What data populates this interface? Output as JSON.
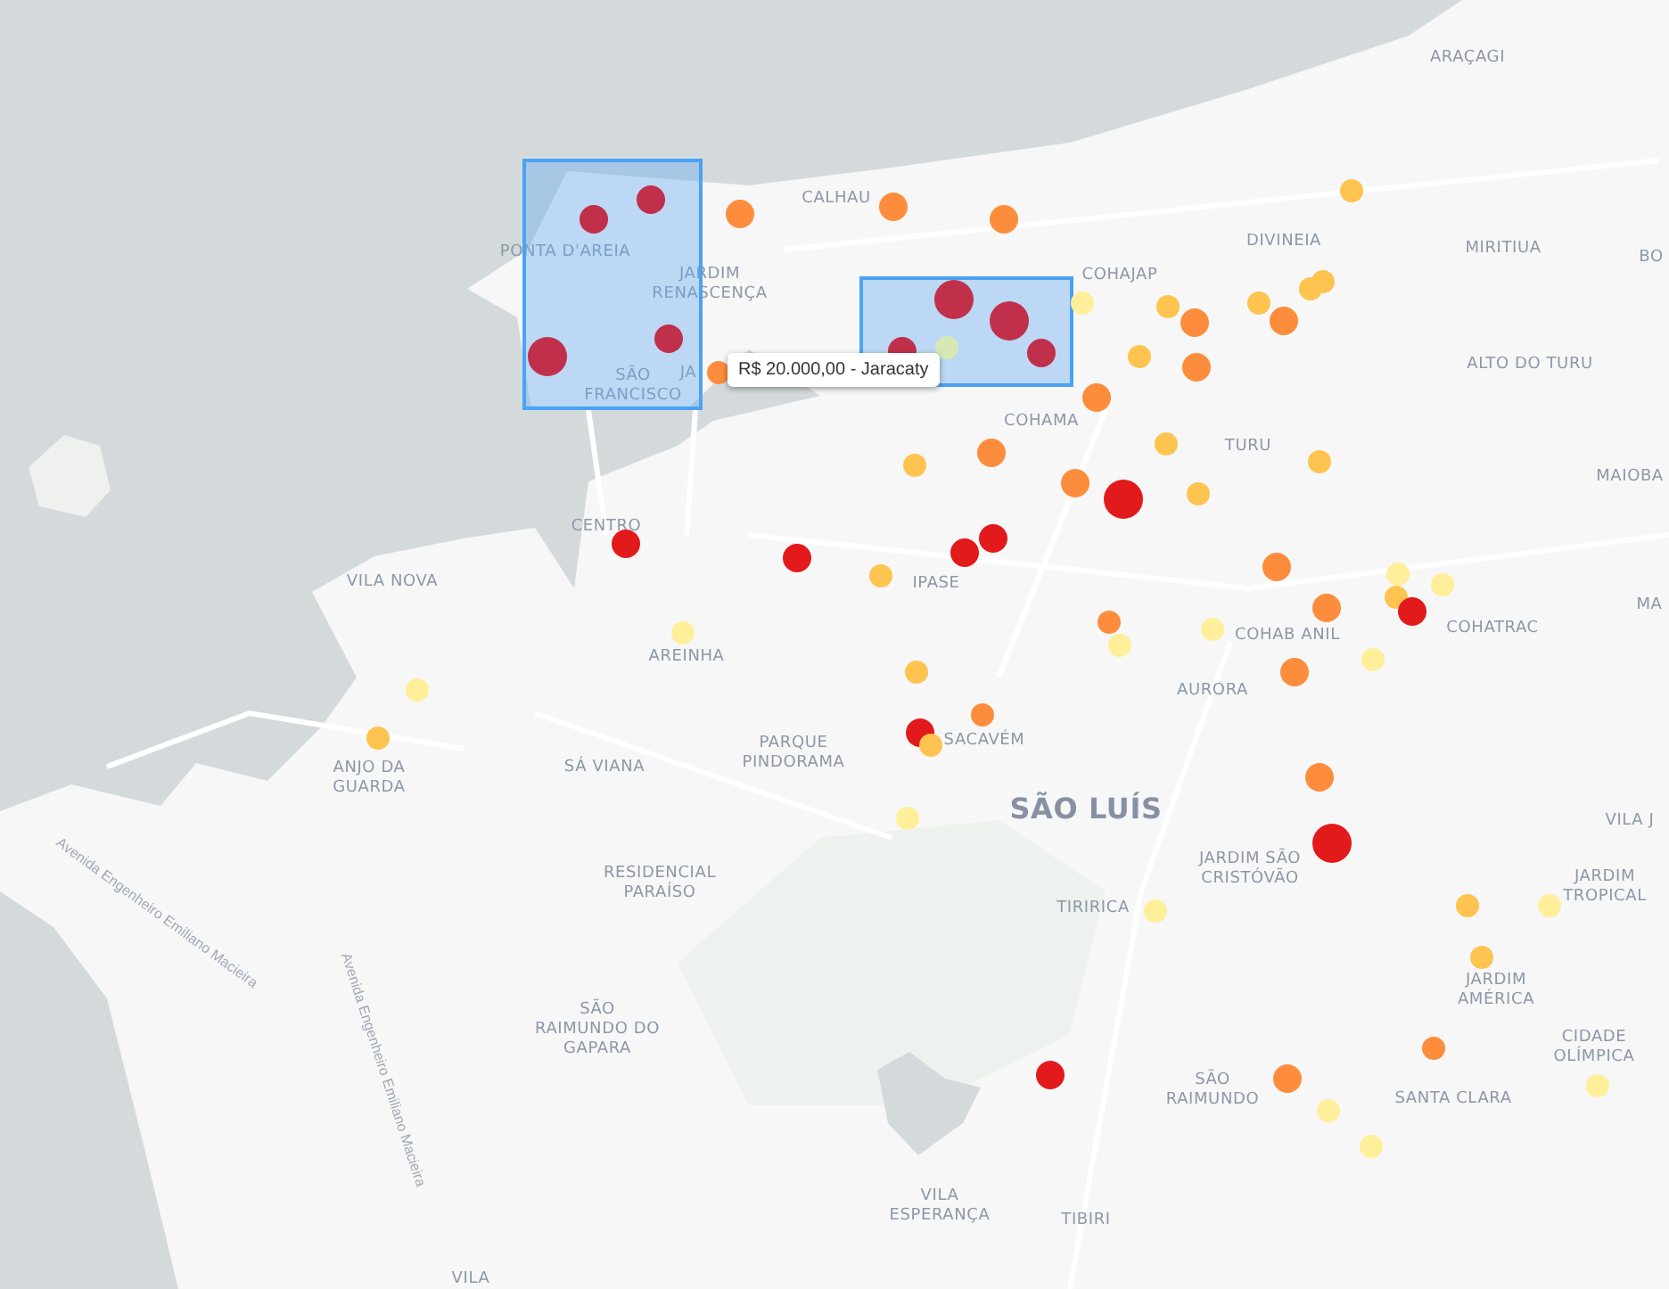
{
  "map": {
    "places": [
      {
        "text": "ARAÇAGI"
      },
      {
        "text": "CALHAU"
      },
      {
        "text": "PONTA D'AREIA"
      },
      {
        "text": "JARDIM RENASCENÇA"
      },
      {
        "text": "COHAJAP"
      },
      {
        "text": "DIVINEIA"
      },
      {
        "text": "MIRITIUA"
      },
      {
        "text": "BO"
      },
      {
        "text": "SÃO FRANCISCO"
      },
      {
        "text": "JA"
      },
      {
        "text": "COHAMA"
      },
      {
        "text": "ALTO DO TURU"
      },
      {
        "text": "TURU"
      },
      {
        "text": "MAIOBA"
      },
      {
        "text": "VILA NOVA"
      },
      {
        "text": "CENTRO"
      },
      {
        "text": "IPASE"
      },
      {
        "text": "COHAB ANIL"
      },
      {
        "text": "COHATRAC"
      },
      {
        "text": "MA"
      },
      {
        "text": "AREINHA"
      },
      {
        "text": "AURORA"
      },
      {
        "text": "SÁ VIANA"
      },
      {
        "text": "PARQUE PINDORAMA"
      },
      {
        "text": "ANJO DA GUARDA"
      },
      {
        "text": "SACAVÉM"
      },
      {
        "text": "SÃO LUÍS",
        "kind": "city"
      },
      {
        "text": "VILA J"
      },
      {
        "text": "JARDIM SÃO CRISTÓVÃO"
      },
      {
        "text": "RESIDENCIAL PARAÍSO"
      },
      {
        "text": "TIRIRICA"
      },
      {
        "text": "JARDIM TROPICAL"
      },
      {
        "text": "JARDIM AMÉRICA"
      },
      {
        "text": "SÃO RAIMUNDO DO GAPARA"
      },
      {
        "text": "CIDADE OLÍMPICA"
      },
      {
        "text": "SÃO RAIMUNDO"
      },
      {
        "text": "SANTA CLARA"
      },
      {
        "text": "VILA ESPERANÇA"
      },
      {
        "text": "TIBIRI"
      },
      {
        "text": "VILA"
      }
    ],
    "streets": [
      {
        "text": "Avenida Engenheiro Emiliano Macieira"
      },
      {
        "text": "Avenida Engenheiro Emiliano Macieira"
      }
    ],
    "markers": [
      {
        "kind": "medium",
        "color": "#c0304a"
      },
      {
        "kind": "medium",
        "color": "#c0304a"
      },
      {
        "kind": "medium",
        "color": "#c0304a"
      },
      {
        "kind": "large",
        "color": "#c0304a"
      },
      {
        "kind": "large",
        "color": "#c0304a"
      },
      {
        "kind": "large",
        "color": "#c0304a"
      },
      {
        "kind": "medium",
        "color": "#c0304a"
      },
      {
        "kind": "medium",
        "color": "#c0304a"
      },
      {
        "kind": "small",
        "color": "#d6e8b4"
      },
      {
        "kind": "medium",
        "color": "#fd8d3c"
      },
      {
        "kind": "medium",
        "color": "#fd8d3c"
      },
      {
        "kind": "medium",
        "color": "#fd8d3c"
      },
      {
        "kind": "small",
        "color": "#fec44f"
      },
      {
        "kind": "small",
        "color": "#ffef9a"
      },
      {
        "kind": "small",
        "color": "#fec44f"
      },
      {
        "kind": "medium",
        "color": "#fd8d3c"
      },
      {
        "kind": "small",
        "color": "#fec44f"
      },
      {
        "kind": "small",
        "color": "#fec44f"
      },
      {
        "kind": "small",
        "color": "#fec44f"
      },
      {
        "kind": "medium",
        "color": "#fd8d3c"
      },
      {
        "kind": "small",
        "color": "#fec44f"
      },
      {
        "kind": "medium",
        "color": "#fd8d3c"
      },
      {
        "kind": "medium",
        "color": "#fd8d3c"
      },
      {
        "kind": "small",
        "color": "#fd8d3c"
      },
      {
        "kind": "medium",
        "color": "#fd8d3c"
      },
      {
        "kind": "small",
        "color": "#fec44f"
      },
      {
        "kind": "small",
        "color": "#fec44f"
      },
      {
        "kind": "medium",
        "color": "#fd8d3c"
      },
      {
        "kind": "large",
        "color": "#e31a1c"
      },
      {
        "kind": "small",
        "color": "#fec44f"
      },
      {
        "kind": "small",
        "color": "#fec44f"
      },
      {
        "kind": "medium",
        "color": "#e31a1c"
      },
      {
        "kind": "medium",
        "color": "#e31a1c"
      },
      {
        "kind": "small",
        "color": "#fec44f"
      },
      {
        "kind": "medium",
        "color": "#e31a1c"
      },
      {
        "kind": "medium",
        "color": "#e31a1c"
      },
      {
        "kind": "medium",
        "color": "#fd8d3c"
      },
      {
        "kind": "medium",
        "color": "#fd8d3c"
      },
      {
        "kind": "small",
        "color": "#fec44f"
      },
      {
        "kind": "small",
        "color": "#ffef9a"
      },
      {
        "kind": "small",
        "color": "#ffef9a"
      },
      {
        "kind": "medium",
        "color": "#e31a1c"
      },
      {
        "kind": "small",
        "color": "#fd8d3c"
      },
      {
        "kind": "small",
        "color": "#ffef9a"
      },
      {
        "kind": "small",
        "color": "#ffef9a"
      },
      {
        "kind": "small",
        "color": "#ffef9a"
      },
      {
        "kind": "small",
        "color": "#ffef9a"
      },
      {
        "kind": "small",
        "color": "#fec44f"
      },
      {
        "kind": "small",
        "color": "#fec44f"
      },
      {
        "kind": "small",
        "color": "#fd8d3c"
      },
      {
        "kind": "medium",
        "color": "#fd8d3c"
      },
      {
        "kind": "small",
        "color": "#ffef9a"
      },
      {
        "kind": "medium",
        "color": "#e31a1c"
      },
      {
        "kind": "small",
        "color": "#fec44f"
      },
      {
        "kind": "small",
        "color": "#ffef9a"
      },
      {
        "kind": "medium",
        "color": "#fd8d3c"
      },
      {
        "kind": "large",
        "color": "#e31a1c"
      },
      {
        "kind": "small",
        "color": "#ffef9a"
      },
      {
        "kind": "small",
        "color": "#fec44f"
      },
      {
        "kind": "small",
        "color": "#ffef9a"
      },
      {
        "kind": "small",
        "color": "#fec44f"
      },
      {
        "kind": "small",
        "color": "#fd8d3c"
      },
      {
        "kind": "medium",
        "color": "#fd8d3c"
      },
      {
        "kind": "medium",
        "color": "#e31a1c"
      },
      {
        "kind": "small",
        "color": "#ffef9a"
      },
      {
        "kind": "small",
        "color": "#ffef9a"
      },
      {
        "kind": "small",
        "color": "#ffef9a"
      }
    ],
    "selections": [
      {
        "kind": "rectangle"
      },
      {
        "kind": "rectangle"
      }
    ],
    "tooltip": {
      "text": "R$ 20.000,00 - Jaracaty"
    }
  }
}
